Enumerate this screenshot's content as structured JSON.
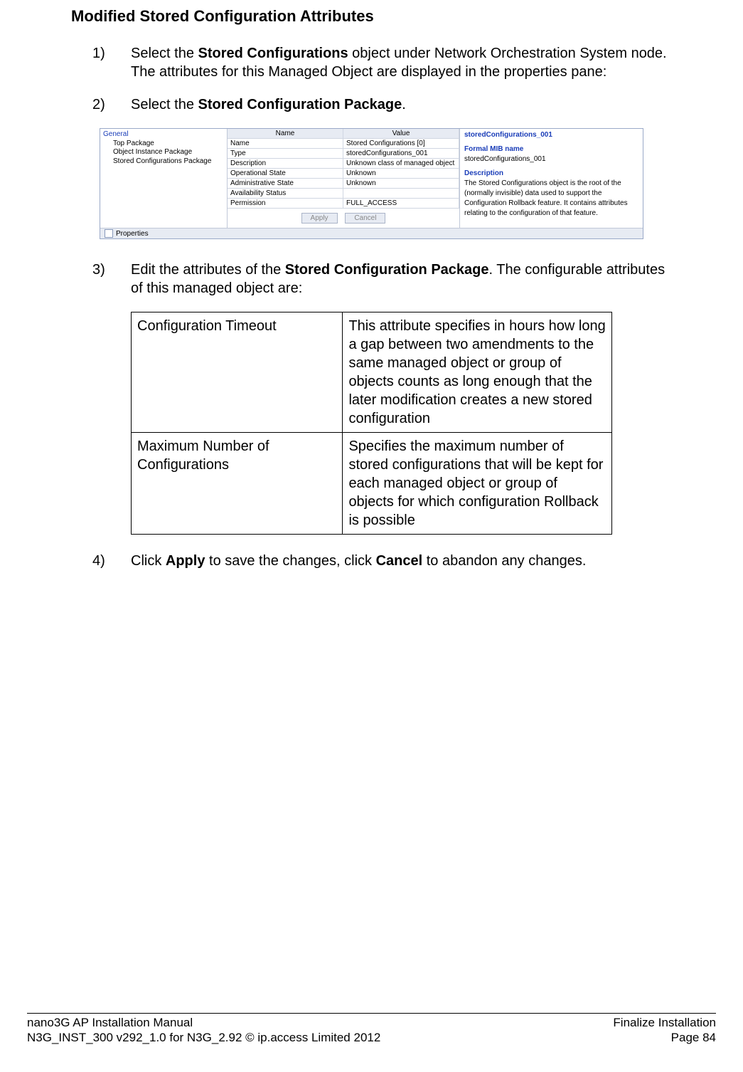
{
  "title": "Modified Stored Configuration Attributes",
  "steps": {
    "s1_num": "1)",
    "s1_a": "Select the ",
    "s1_b": "Stored Configurations",
    "s1_c": " object under Network Orchestration System node. The attributes for this Managed Object are displayed in the properties pane:",
    "s2_num": "2)",
    "s2_a": "Select the ",
    "s2_b": "Stored Configuration Package",
    "s2_c": ".",
    "s3_num": "3)",
    "s3_a": "Edit the attributes of the ",
    "s3_b": "Stored Configuration Package",
    "s3_c": ". The configurable attributes of this managed object are:",
    "s4_num": "4)",
    "s4_a": "Click ",
    "s4_b": "Apply",
    "s4_c": " to save the changes, click ",
    "s4_d": "Cancel",
    "s4_e": " to abandon any changes."
  },
  "props": {
    "tree": {
      "root": "General",
      "items": [
        "Top Package",
        "Object Instance Package",
        "Stored Configurations Package"
      ]
    },
    "columns": {
      "name": "Name",
      "value": "Value"
    },
    "rows": [
      {
        "name": "Name",
        "value": "Stored Configurations [0]"
      },
      {
        "name": "Type",
        "value": "storedConfigurations_001"
      },
      {
        "name": "Description",
        "value": "Unknown class of managed object"
      },
      {
        "name": "Operational State",
        "value": "Unknown"
      },
      {
        "name": "Administrative State",
        "value": "Unknown"
      },
      {
        "name": "Availability Status",
        "value": ""
      },
      {
        "name": "Permission",
        "value": "FULL_ACCESS"
      }
    ],
    "buttons": {
      "apply": "Apply",
      "cancel": "Cancel"
    },
    "help": {
      "title": "storedConfigurations_001",
      "mib_label": "Formal MIB name",
      "mib_value": "storedConfigurations_001",
      "desc_label": "Description",
      "desc_text": "The Stored Configurations object is the root of the (normally invisible) data used to support the Configuration Rollback feature. It contains attributes relating to the configuration of that feature."
    },
    "bottom_tab": "Properties"
  },
  "attr_table": {
    "rows": [
      {
        "name": "Configuration Timeout",
        "desc": "This attribute specifies in hours how long a gap between two amendments to the same managed object or group of objects counts as long enough that the later modification creates a new stored configuration"
      },
      {
        "name": "Maximum Number of Configurations",
        "desc": "Specifies the maximum number of stored configurations that will be kept for each managed object or group of objects for which configuration Rollback is possible"
      }
    ]
  },
  "footer": {
    "l1_left": "nano3G AP Installation Manual",
    "l1_right": "Finalize Installation",
    "l2_left": "N3G_INST_300 v292_1.0 for N3G_2.92 © ip.access Limited 2012",
    "l2_right": "Page 84"
  }
}
